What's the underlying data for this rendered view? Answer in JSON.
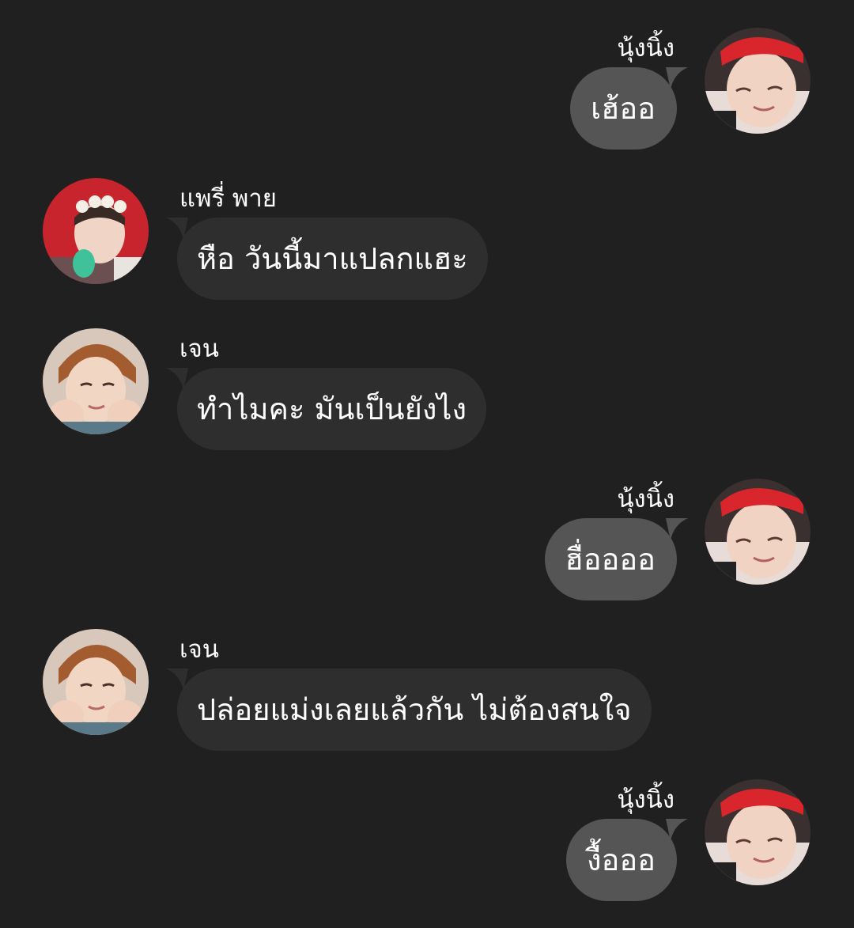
{
  "colors": {
    "background": "#202020",
    "incoming_bubble": "#2e2e2e",
    "outgoing_bubble": "#555555",
    "text": "#ffffff"
  },
  "messages": [
    {
      "sender": "นุ้งนิ้ง",
      "text": "เฮ้ออ",
      "direction": "outgoing",
      "avatar": "avatar-red-bandana"
    },
    {
      "sender": "แพรี่ พาย",
      "text": "หือ วันนี้มาแปลกแฮะ",
      "direction": "incoming",
      "avatar": "avatar-flower-crown"
    },
    {
      "sender": "เจน",
      "text": "ทำไมคะ มันเป็นยังไง",
      "direction": "incoming",
      "avatar": "avatar-hands-on-cheeks"
    },
    {
      "sender": "นุ้งนิ้ง",
      "text": "ฮื่ออออ",
      "direction": "outgoing",
      "avatar": "avatar-red-bandana"
    },
    {
      "sender": "เจน",
      "text": "ปล่อยแม่งเลยแล้วกัน ไม่ต้องสนใจ",
      "direction": "incoming",
      "avatar": "avatar-hands-on-cheeks"
    },
    {
      "sender": "นุ้งนิ้ง",
      "text": "งื้อออ",
      "direction": "outgoing",
      "avatar": "avatar-red-bandana"
    }
  ]
}
